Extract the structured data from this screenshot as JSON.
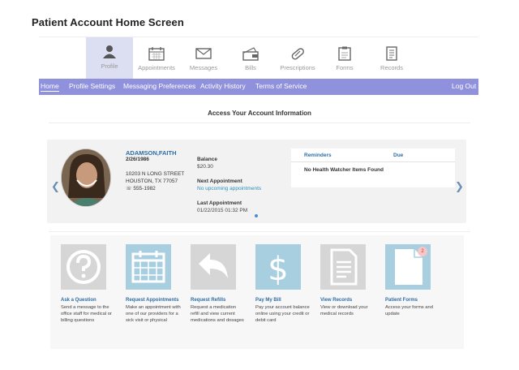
{
  "page": {
    "title": "Patient Account Home Screen"
  },
  "top_nav": [
    {
      "label": "Profile",
      "icon": "user-icon",
      "active": true
    },
    {
      "label": "Appointments",
      "icon": "calendar-icon"
    },
    {
      "label": "Messages",
      "icon": "envelope-icon"
    },
    {
      "label": "Bills",
      "icon": "wallet-icon"
    },
    {
      "label": "Prescriptions",
      "icon": "pill-icon"
    },
    {
      "label": "Forms",
      "icon": "clipboard-icon"
    },
    {
      "label": "Records",
      "icon": "records-icon"
    }
  ],
  "tabs": [
    "Home",
    "Profile Settings",
    "Messaging Preferences",
    "Activity History",
    "Terms of Service"
  ],
  "logout": "Log Out",
  "section_title": "Access Your Account Information",
  "patient": {
    "name": "ADAMSON,FAITH",
    "dob": "2/26/1986",
    "address_line1": "10203 N LONG STREET",
    "address_line2": "HOUSTON, TX 77057",
    "phone": "555-1982"
  },
  "account": {
    "balance_label": "Balance",
    "balance_value": "$20.30",
    "next_label": "Next Appointment",
    "next_value": "No upcoming appointments",
    "last_label": "Last Appointment",
    "last_value": "01/22/2015 01:32 PM"
  },
  "reminders": {
    "col1": "Reminders",
    "col2": "Due",
    "empty": "No Health Watcher Items Found"
  },
  "tiles": [
    {
      "title": "Ask a Question",
      "desc": "Send a message to the office staff for medical or billing questions",
      "icon": "question-icon",
      "color": "#d6d6d6"
    },
    {
      "title": "Request Appointments",
      "desc": "Make an appointment with one of our providers for a sick visit or physical",
      "icon": "calendar-icon",
      "color": "#a8cfe0"
    },
    {
      "title": "Request Refills",
      "desc": "Request a medication refill and view current medications and dosages",
      "icon": "refill-arrow-icon",
      "color": "#d6d6d6"
    },
    {
      "title": "Pay My Bill",
      "desc": "Pay your account balance online using your credit or debit card",
      "icon": "dollar-icon",
      "color": "#a8cfe0"
    },
    {
      "title": "View Records",
      "desc": "View or download your medical records",
      "icon": "document-icon",
      "color": "#d6d6d6"
    },
    {
      "title": "Patient Forms",
      "desc": "Access your forms and update",
      "icon": "form-icon",
      "color": "#a8cfe0",
      "badge": "2"
    }
  ],
  "colors": {
    "tab_bar": "#8f91dc",
    "active_nav": "#dcdff2",
    "link": "#2f6ea6",
    "tile_blue": "#a8cfe0",
    "tile_gray": "#d6d6d6"
  }
}
